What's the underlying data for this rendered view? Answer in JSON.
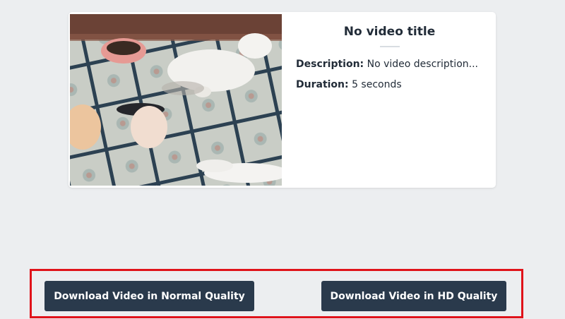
{
  "video": {
    "title": "No video title",
    "description_label": "Description:",
    "description": "No video description...",
    "duration_label": "Duration:",
    "duration": "5 seconds",
    "thumbnail": "video-thumbnail-cats-on-tiled-floor"
  },
  "downloads": {
    "normal_label": "Download Video in Normal Quality",
    "hd_label": "Download Video in HD Quality"
  },
  "colors": {
    "page_background": "#eceef0",
    "button_background": "#2a3a4c",
    "highlight_border": "#e0131a"
  }
}
